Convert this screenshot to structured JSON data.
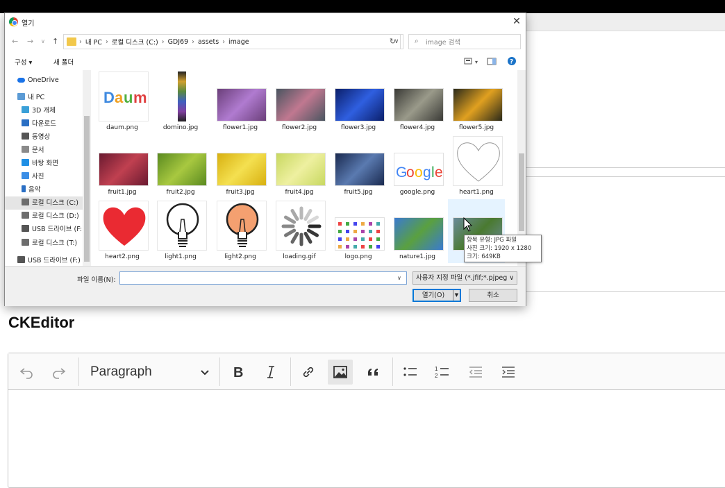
{
  "dialog": {
    "title": "열기",
    "close_label": "✕",
    "breadcrumbs": [
      "내 PC",
      "로컬 디스크 (C:)",
      "GDJ69",
      "assets",
      "image"
    ],
    "search_placeholder": "image 검색",
    "organize_label": "구성 ▾",
    "new_folder_label": "새 폴더",
    "help_label": "?"
  },
  "sidebar": {
    "items": [
      {
        "label": "OneDrive",
        "icon": "cloud-icon",
        "color": "#1a73e8"
      },
      {
        "label": "내 PC",
        "icon": "computer-icon",
        "color": "#5b9bd5"
      },
      {
        "label": "3D 개체",
        "icon": "cube-icon",
        "color": "#3aa0d8"
      },
      {
        "label": "다운로드",
        "icon": "download-icon",
        "color": "#2a6fc4"
      },
      {
        "label": "동영상",
        "icon": "video-icon",
        "color": "#555555"
      },
      {
        "label": "문서",
        "icon": "document-icon",
        "color": "#8a8a8a"
      },
      {
        "label": "바탕 화면",
        "icon": "desktop-icon",
        "color": "#1f8fe5"
      },
      {
        "label": "사진",
        "icon": "picture-icon",
        "color": "#3a8ee6"
      },
      {
        "label": "음악",
        "icon": "music-icon",
        "color": "#2a6fc4"
      },
      {
        "label": "로컬 디스크 (C:)",
        "icon": "drive-icon",
        "color": "#6d6d6d"
      },
      {
        "label": "로컬 디스크 (D:)",
        "icon": "drive-icon",
        "color": "#6d6d6d"
      },
      {
        "label": "USB 드라이브 (F:)",
        "icon": "usb-drive-icon",
        "color": "#555555"
      },
      {
        "label": "로컬 디스크 (T:)",
        "icon": "drive-icon",
        "color": "#6d6d6d"
      },
      {
        "label": "USB 드라이브 (F:)",
        "icon": "usb-drive-icon",
        "color": "#555555"
      }
    ]
  },
  "files": [
    {
      "name": "daum.png",
      "kind": "daum"
    },
    {
      "name": "domino.jpg",
      "kind": "domino"
    },
    {
      "name": "flower1.jpg",
      "kind": "photo",
      "c1": "#6b3f7a",
      "c2": "#b07bd0"
    },
    {
      "name": "flower2.jpg",
      "kind": "photo",
      "c1": "#4a5560",
      "c2": "#c07890"
    },
    {
      "name": "flower3.jpg",
      "kind": "photo",
      "c1": "#0b1f6b",
      "c2": "#2f5fe0"
    },
    {
      "name": "flower4.jpg",
      "kind": "photo",
      "c1": "#3a3a36",
      "c2": "#9a9a8a"
    },
    {
      "name": "flower5.jpg",
      "kind": "photo",
      "c1": "#2a2a1a",
      "c2": "#e0a020"
    },
    {
      "name": "fruit1.jpg",
      "kind": "photo",
      "c1": "#6a1a30",
      "c2": "#c04050"
    },
    {
      "name": "fruit2.jpg",
      "kind": "photo",
      "c1": "#5a8a20",
      "c2": "#a8c840"
    },
    {
      "name": "fruit3.jpg",
      "kind": "photo",
      "c1": "#d8b010",
      "c2": "#f4e050"
    },
    {
      "name": "fruit4.jpg",
      "kind": "photo",
      "c1": "#c8d860",
      "c2": "#eef0a0"
    },
    {
      "name": "fruit5.jpg",
      "kind": "photo",
      "c1": "#1a2a50",
      "c2": "#5a7ab0"
    },
    {
      "name": "google.png",
      "kind": "google",
      "text": "Google"
    },
    {
      "name": "heart1.png",
      "kind": "heart-outline"
    },
    {
      "name": "heart2.png",
      "kind": "heart-red"
    },
    {
      "name": "light1.png",
      "kind": "bulb",
      "fill": "#ffffff"
    },
    {
      "name": "light2.png",
      "kind": "bulb",
      "fill": "#f4a070"
    },
    {
      "name": "loading.gif",
      "kind": "loading"
    },
    {
      "name": "logo.png",
      "kind": "logo"
    },
    {
      "name": "nature1.jpg",
      "kind": "photo",
      "c1": "#3a7ad0",
      "c2": "#5aa040"
    },
    {
      "name": "",
      "kind": "photo",
      "c1": "#6a8a9a",
      "c2": "#4a7a30"
    }
  ],
  "tooltip": {
    "line1": "항목 유형: JPG 파일",
    "line2": "사진 크기: 1920 x 1280",
    "line3": "크기: 649KB"
  },
  "bottom": {
    "filename_label": "파일 이름(N):",
    "filename_value": "",
    "filetype_label": "사용자 지정 파일 (*.jfif;*.pjpeg ∨",
    "open_label": "열기(O)",
    "cancel_label": "취소"
  },
  "page": {
    "heading": "CKEditor"
  },
  "editor": {
    "paragraph_label": "Paragraph",
    "active_color": "#e6e6e6"
  }
}
